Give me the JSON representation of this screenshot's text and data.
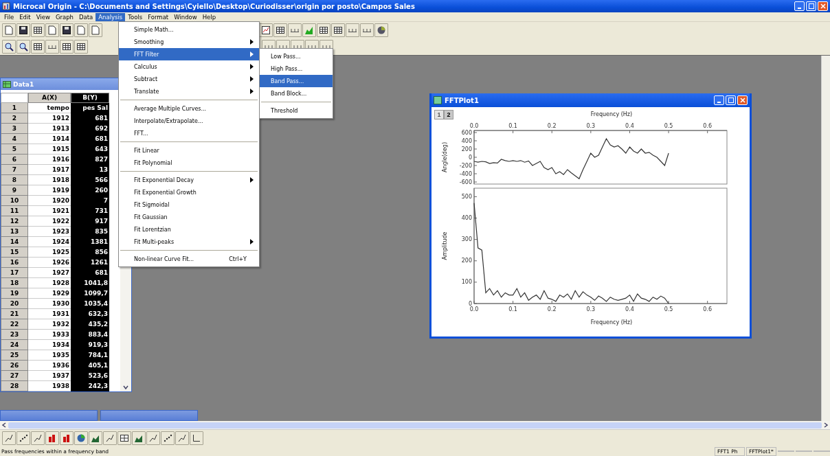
{
  "window": {
    "title": "Microcal Origin - C:\\Documents and Settings\\Cyiello\\Desktop\\Curiodisser\\origin por posto\\Campos Sales"
  },
  "menu_bar": [
    {
      "label": "File",
      "selected": false
    },
    {
      "label": "Edit",
      "selected": false
    },
    {
      "label": "View",
      "selected": false
    },
    {
      "label": "Graph",
      "selected": false
    },
    {
      "label": "Data",
      "selected": false
    },
    {
      "label": "Analysis",
      "selected": true
    },
    {
      "label": "Tools",
      "selected": false
    },
    {
      "label": "Format",
      "selected": false
    },
    {
      "label": "Window",
      "selected": false
    },
    {
      "label": "Help",
      "selected": false
    }
  ],
  "analysis_menu": [
    {
      "kind": "item",
      "label": "Simple Math...",
      "submenu": false,
      "selected": false
    },
    {
      "kind": "item",
      "label": "Smoothing",
      "submenu": true,
      "selected": false
    },
    {
      "kind": "item",
      "label": "FFT Filter",
      "submenu": true,
      "selected": true
    },
    {
      "kind": "item",
      "label": "Calculus",
      "submenu": true,
      "selected": false
    },
    {
      "kind": "item",
      "label": "Subtract",
      "submenu": true,
      "selected": false
    },
    {
      "kind": "item",
      "label": "Translate",
      "submenu": true,
      "selected": false
    },
    {
      "kind": "separator"
    },
    {
      "kind": "item",
      "label": "Average Multiple Curves...",
      "submenu": false,
      "selected": false
    },
    {
      "kind": "item",
      "label": "Interpolate/Extrapolate...",
      "submenu": false,
      "selected": false
    },
    {
      "kind": "item",
      "label": "FFT...",
      "submenu": false,
      "selected": false
    },
    {
      "kind": "separator"
    },
    {
      "kind": "item",
      "label": "Fit Linear",
      "submenu": false,
      "selected": false
    },
    {
      "kind": "item",
      "label": "Fit Polynomial",
      "submenu": false,
      "selected": false
    },
    {
      "kind": "separator"
    },
    {
      "kind": "item",
      "label": "Fit Exponential Decay",
      "submenu": true,
      "selected": false
    },
    {
      "kind": "item",
      "label": "Fit Exponential Growth",
      "submenu": false,
      "selected": false
    },
    {
      "kind": "item",
      "label": "Fit Sigmoidal",
      "submenu": false,
      "selected": false
    },
    {
      "kind": "item",
      "label": "Fit Gaussian",
      "submenu": false,
      "selected": false
    },
    {
      "kind": "item",
      "label": "Fit Lorentzian",
      "submenu": false,
      "selected": false
    },
    {
      "kind": "item",
      "label": "Fit Multi-peaks",
      "submenu": true,
      "selected": false
    },
    {
      "kind": "separator"
    },
    {
      "kind": "item",
      "label": "Non-linear Curve Fit...",
      "shortcut": "Ctrl+Y",
      "submenu": false,
      "selected": false
    }
  ],
  "fft_filter_submenu": [
    {
      "kind": "item",
      "label": "Low Pass...",
      "selected": false
    },
    {
      "kind": "item",
      "label": "High Pass...",
      "selected": false
    },
    {
      "kind": "item",
      "label": "Band Pass...",
      "selected": true
    },
    {
      "kind": "item",
      "label": "Band Block...",
      "selected": false
    },
    {
      "kind": "separator"
    },
    {
      "kind": "item",
      "label": "Threshold",
      "selected": false
    }
  ],
  "worksheet": {
    "title": "Data1",
    "columns": [
      {
        "label": "A(X)",
        "selected": false
      },
      {
        "label": "B(Y)",
        "selected": true
      }
    ],
    "rows": [
      {
        "number": "1",
        "cells": [
          "tempo",
          "pes Sal"
        ]
      },
      {
        "number": "2",
        "cells": [
          "1912",
          "681"
        ]
      },
      {
        "number": "3",
        "cells": [
          "1913",
          "692"
        ]
      },
      {
        "number": "4",
        "cells": [
          "1914",
          "681"
        ]
      },
      {
        "number": "5",
        "cells": [
          "1915",
          "643"
        ]
      },
      {
        "number": "6",
        "cells": [
          "1916",
          "827"
        ]
      },
      {
        "number": "7",
        "cells": [
          "1917",
          "13"
        ]
      },
      {
        "number": "8",
        "cells": [
          "1918",
          "566"
        ]
      },
      {
        "number": "9",
        "cells": [
          "1919",
          "260"
        ]
      },
      {
        "number": "10",
        "cells": [
          "1920",
          "7"
        ]
      },
      {
        "number": "11",
        "cells": [
          "1921",
          "731"
        ]
      },
      {
        "number": "12",
        "cells": [
          "1922",
          "917"
        ]
      },
      {
        "number": "13",
        "cells": [
          "1923",
          "835"
        ]
      },
      {
        "number": "14",
        "cells": [
          "1924",
          "1381"
        ]
      },
      {
        "number": "15",
        "cells": [
          "1925",
          "856"
        ]
      },
      {
        "number": "16",
        "cells": [
          "1926",
          "1261"
        ]
      },
      {
        "number": "17",
        "cells": [
          "1927",
          "681"
        ]
      },
      {
        "number": "18",
        "cells": [
          "1928",
          "1041,8"
        ]
      },
      {
        "number": "19",
        "cells": [
          "1929",
          "1099,7"
        ]
      },
      {
        "number": "20",
        "cells": [
          "1930",
          "1035,4"
        ]
      },
      {
        "number": "21",
        "cells": [
          "1931",
          "632,3"
        ]
      },
      {
        "number": "22",
        "cells": [
          "1932",
          "435,2"
        ]
      },
      {
        "number": "23",
        "cells": [
          "1933",
          "883,4"
        ]
      },
      {
        "number": "24",
        "cells": [
          "1934",
          "919,3"
        ]
      },
      {
        "number": "25",
        "cells": [
          "1935",
          "784,1"
        ]
      },
      {
        "number": "26",
        "cells": [
          "1936",
          "405,1"
        ]
      },
      {
        "number": "27",
        "cells": [
          "1937",
          "523,6"
        ]
      },
      {
        "number": "28",
        "cells": [
          "1938",
          "242,3"
        ]
      }
    ]
  },
  "plot_window": {
    "title": "FFTPlot1",
    "layers": [
      {
        "label": "1",
        "selected": false
      },
      {
        "label": "2",
        "selected": true
      }
    ],
    "panels": [
      {
        "chart_data": {
          "type": "line",
          "xlabel": "Frequency (Hz)",
          "ylabel": "Angle(deg)",
          "x": [
            0,
            0.01,
            0.02,
            0.03,
            0.04,
            0.05,
            0.06,
            0.07,
            0.08,
            0.09,
            0.1,
            0.11,
            0.12,
            0.13,
            0.14,
            0.15,
            0.16,
            0.17,
            0.18,
            0.19,
            0.2,
            0.21,
            0.22,
            0.23,
            0.24,
            0.25,
            0.26,
            0.27,
            0.28,
            0.29,
            0.3,
            0.31,
            0.32,
            0.33,
            0.34,
            0.35,
            0.36,
            0.37,
            0.38,
            0.39,
            0.4,
            0.41,
            0.42,
            0.43,
            0.44,
            0.45,
            0.46,
            0.47,
            0.48,
            0.49,
            0.5
          ],
          "series": [
            {
              "values": [
                -100,
                -120,
                -100,
                -110,
                -150,
                -130,
                -140,
                -50,
                -80,
                -100,
                -80,
                -100,
                -80,
                -120,
                -90,
                -200,
                -150,
                -100,
                -250,
                -300,
                -250,
                -400,
                -350,
                -420,
                -300,
                -380,
                -450,
                -520,
                -300,
                -100,
                100,
                0,
                50,
                250,
                450,
                300,
                250,
                280,
                200,
                100,
                250,
                150,
                100,
                200,
                100,
                120,
                50,
                0,
                -100,
                -200,
                100
              ]
            }
          ],
          "xlim": [
            0,
            0.65
          ],
          "ylim": [
            -650,
            650
          ],
          "xticks": [
            {
              "value": 0,
              "label": "0.0"
            },
            {
              "value": 0.1,
              "label": "0.1"
            },
            {
              "value": 0.2,
              "label": "0.2"
            },
            {
              "value": 0.3,
              "label": "0.3"
            },
            {
              "value": 0.4,
              "label": "0.4"
            },
            {
              "value": 0.5,
              "label": "0.5"
            },
            {
              "value": 0.6,
              "label": "0.6"
            }
          ],
          "yticks": [
            -600,
            -400,
            -200,
            0,
            200,
            400,
            600
          ]
        }
      },
      {
        "chart_data": {
          "type": "line",
          "xlabel": "Frequency (Hz)",
          "ylabel": "Amplitude",
          "x": [
            0,
            0.01,
            0.02,
            0.03,
            0.04,
            0.05,
            0.06,
            0.07,
            0.08,
            0.09,
            0.1,
            0.11,
            0.12,
            0.13,
            0.14,
            0.15,
            0.16,
            0.17,
            0.18,
            0.19,
            0.2,
            0.21,
            0.22,
            0.23,
            0.24,
            0.25,
            0.26,
            0.27,
            0.28,
            0.29,
            0.3,
            0.31,
            0.32,
            0.33,
            0.34,
            0.35,
            0.36,
            0.37,
            0.38,
            0.39,
            0.4,
            0.41,
            0.42,
            0.43,
            0.44,
            0.45,
            0.46,
            0.47,
            0.48,
            0.49,
            0.5
          ],
          "series": [
            {
              "values": [
                470,
                260,
                250,
                50,
                70,
                40,
                60,
                30,
                50,
                40,
                40,
                70,
                30,
                50,
                15,
                30,
                40,
                20,
                60,
                25,
                20,
                10,
                40,
                30,
                45,
                20,
                60,
                30,
                55,
                40,
                30,
                15,
                35,
                25,
                10,
                30,
                20,
                15,
                20,
                25,
                40,
                10,
                45,
                25,
                20,
                10,
                30,
                20,
                35,
                25,
                0
              ]
            }
          ],
          "xlim": [
            0,
            0.65
          ],
          "ylim": [
            0,
            540
          ],
          "xticks": [
            {
              "value": 0,
              "label": "0.0"
            },
            {
              "value": 0.1,
              "label": "0.1"
            },
            {
              "value": 0.2,
              "label": "0.2"
            },
            {
              "value": 0.3,
              "label": "0.3"
            },
            {
              "value": 0.4,
              "label": "0.4"
            },
            {
              "value": 0.5,
              "label": "0.5"
            },
            {
              "value": 0.6,
              "label": "0.6"
            }
          ],
          "yticks": [
            0,
            100,
            200,
            300,
            400,
            500
          ]
        }
      }
    ]
  },
  "status_bar": {
    "message": "Pass frequencies within a frequency band",
    "panels": [
      "FFT1 Ph",
      "FFTPlot1*"
    ]
  }
}
